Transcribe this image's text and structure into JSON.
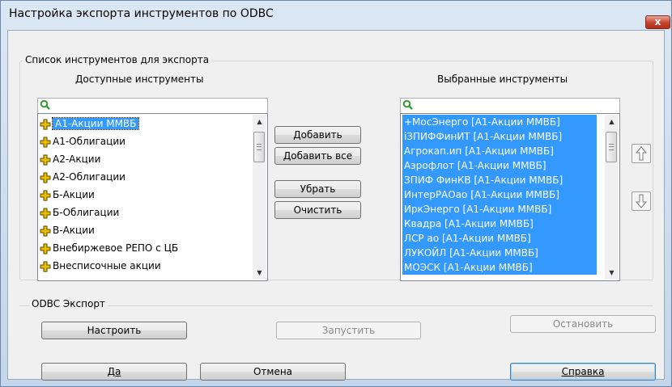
{
  "window": {
    "title": "Настройка экспорта инструментов по ODBC",
    "close_glyph": "x"
  },
  "export_group": {
    "legend": "Список инструментов для экспорта",
    "available_label": "Доступные инструменты",
    "selected_label": "Выбранные инструменты",
    "search_icon": "magnifier-icon",
    "available_items": [
      "А1-Акции ММВБ",
      "А1-Облигации",
      "А2-Акции",
      "А2-Облигации",
      "Б-Акции",
      "Б-Облигации",
      "В-Акции",
      "Внебиржевое РЕПО с ЦБ",
      "Внесписочные акции"
    ],
    "selected_items": [
      "+МосЭнерго [А1-Акции ММВБ]",
      "іЗПИФФинИТ [А1-Акции ММВБ]",
      "Агрокап.ип [А1-Акции ММВБ]",
      "Аэрофлот [А1-Акции ММВБ]",
      "ЗПИФ ФинКВ [А1-Акции ММВБ]",
      "ИнтерРАОао [А1-Акции ММВБ]",
      "ИркЭнерго [А1-Акции ММВБ]",
      "Квадра [А1-Акции ММВБ]",
      "ЛСР ао [А1-Акции ММВБ]",
      "ЛУКОЙЛ [А1-Акции ММВБ]",
      "МОЭСК [А1-Акции ММВБ]"
    ],
    "buttons": {
      "add": "Добавить",
      "add_all": "Добавить все",
      "remove": "Убрать",
      "clear": "Очистить"
    }
  },
  "odbc_group": {
    "legend": "ODBC Экспорт",
    "configure": "Настроить",
    "run": "Запустить",
    "stop": "Остановить"
  },
  "footer": {
    "ok": "Да",
    "cancel": "Отмена",
    "help": "Справка"
  },
  "colors": {
    "selection": "#3399ff",
    "plus_icon": "#e8c000"
  }
}
